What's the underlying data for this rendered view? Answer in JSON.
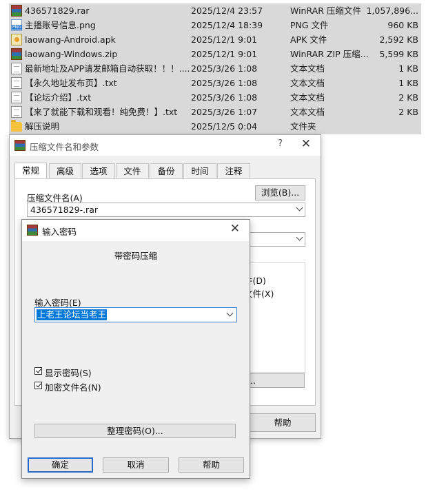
{
  "files": [
    {
      "icon": "rar-icon",
      "name": "436571829.rar",
      "date": "2025/12/4 23:57",
      "type": "WinRAR 压缩文件",
      "size": "1,057,896..."
    },
    {
      "icon": "png-icon",
      "name": "主播账号信息.png",
      "date": "2025/12/4 18:39",
      "type": "PNG 文件",
      "size": "960 KB"
    },
    {
      "icon": "apk-icon",
      "name": "laowang-Android.apk",
      "date": "2025/12/1 9:01",
      "type": "APK 文件",
      "size": "2,592 KB"
    },
    {
      "icon": "zip-icon",
      "name": "laowang-Windows.zip",
      "date": "2025/12/1 9:01",
      "type": "WinRAR ZIP 压缩...",
      "size": "5,599 KB"
    },
    {
      "icon": "txt-icon",
      "name": "最新地址及APP请发邮箱自动获取！！！....",
      "date": "2025/3/26 1:08",
      "type": "文本文档",
      "size": "1 KB"
    },
    {
      "icon": "txt-icon",
      "name": "【永久地址发布页】.txt",
      "date": "2025/3/26 1:08",
      "type": "文本文档",
      "size": "1 KB"
    },
    {
      "icon": "txt-icon",
      "name": "【论坛介绍】.txt",
      "date": "2025/3/26 1:08",
      "type": "文本文档",
      "size": "2 KB"
    },
    {
      "icon": "txt-icon",
      "name": "【来了就能下载和观看！纯免费！】.txt",
      "date": "2025/3/26 1:07",
      "type": "文本文档",
      "size": "2 KB"
    },
    {
      "icon": "folder-icon",
      "name": "解压说明",
      "date": "2025/12/5 0:04",
      "type": "文件夹",
      "size": ""
    }
  ],
  "archive_dialog": {
    "title": "压缩文件名和参数",
    "help_q": "?",
    "close": "✕",
    "tabs": [
      "常规",
      "高级",
      "选项",
      "文件",
      "备份",
      "时间",
      "注释"
    ],
    "archive_name_label": "压缩文件名(A)",
    "browse_button": "浏览(B)...",
    "archive_name_value": "436571829-.rar",
    "partial_option_1": "件(D)",
    "partial_option_2": "文件(X)",
    "partial_button": "...",
    "help_button": "帮助"
  },
  "password_dialog": {
    "title": "输入密码",
    "close": "✕",
    "heading": "带密码压缩",
    "password_label": "输入密码(E)",
    "password_value": "上老王论坛当老王",
    "show_password": "显示密码(S)",
    "encrypt_filenames": "加密文件名(N)",
    "organize_button": "整理密码(O)...",
    "ok_button": "确定",
    "cancel_button": "取消",
    "help_button": "帮助"
  },
  "colors": {
    "selection": "#0078d7",
    "list_bg": "#d9d9d9",
    "dialog_bg": "#f0f0f0"
  }
}
